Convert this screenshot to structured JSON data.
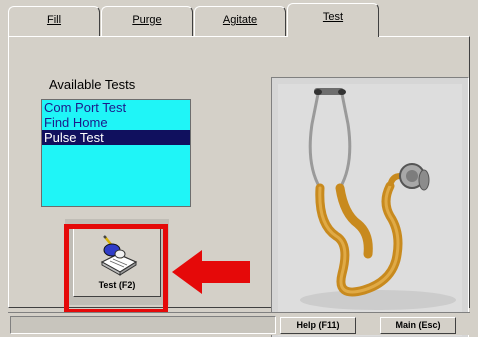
{
  "tabs": [
    {
      "label": "Fill",
      "active": false
    },
    {
      "label": "Purge",
      "active": false
    },
    {
      "label": "Agitate",
      "active": false
    },
    {
      "label": "Test",
      "active": true
    }
  ],
  "tests": {
    "label": "Available Tests",
    "items": [
      "Com Port Test",
      "Find Home",
      "Pulse Test"
    ],
    "selected_index": 2
  },
  "test_button": {
    "label": "Test (F2)",
    "icon": "hand-writing-icon"
  },
  "footer": {
    "help_label": "Help (F11)",
    "main_label": "Main (Esc)"
  },
  "image": {
    "icon": "stethoscope-icon"
  },
  "colors": {
    "list_background": "#1ff5f7",
    "list_text": "#1c1a8a",
    "selection": "#10105e",
    "highlight": "#e50909",
    "window": "#d4d0c8",
    "stethoscope_tube": "#c88a1e"
  }
}
